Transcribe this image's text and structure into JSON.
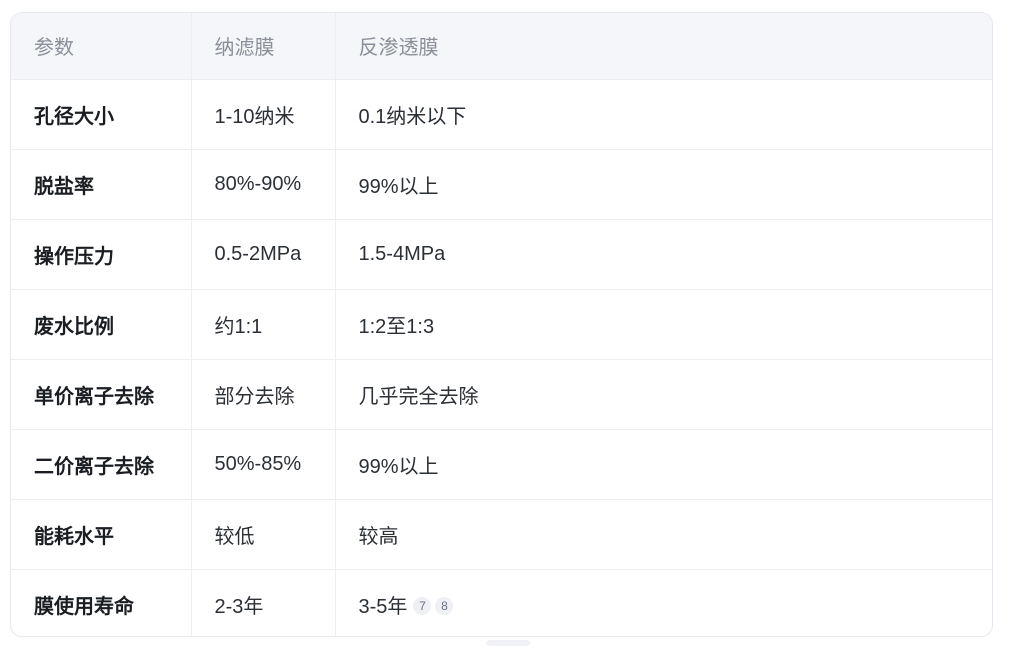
{
  "table": {
    "headers": [
      "参数",
      "纳滤膜",
      "反渗透膜"
    ],
    "rows": [
      {
        "param": "孔径大小",
        "nf": "1-10纳米",
        "ro": "0.1纳米以下"
      },
      {
        "param": "脱盐率",
        "nf": "80%-90%",
        "ro": "99%以上"
      },
      {
        "param": "操作压力",
        "nf": "0.5-2MPa",
        "ro": "1.5-4MPa"
      },
      {
        "param": "废水比例",
        "nf": "约1:1",
        "ro": "1:2至1:3"
      },
      {
        "param": "单价离子去除",
        "nf": "部分去除",
        "ro": "几乎完全去除"
      },
      {
        "param": "二价离子去除",
        "nf": "50%-85%",
        "ro": "99%以上"
      },
      {
        "param": "能耗水平",
        "nf": "较低",
        "ro": "较高"
      },
      {
        "param": "膜使用寿命",
        "nf": "2-3年",
        "ro": "3-5年"
      }
    ],
    "citations": [
      "7",
      "8"
    ]
  }
}
